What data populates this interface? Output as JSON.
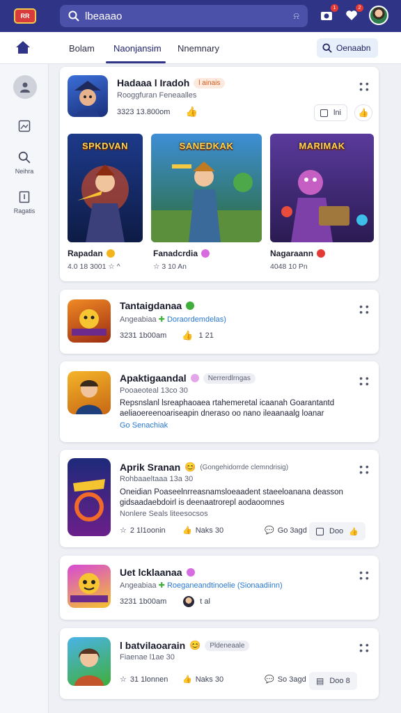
{
  "app": {
    "logo_text": "RR"
  },
  "search": {
    "value": "lbeaaao"
  },
  "topbar": {
    "badge1": "1",
    "badge2": "2"
  },
  "tabs": [
    "Bolam",
    "Naonjansim",
    "Nnemnary"
  ],
  "header_action": {
    "label": "Oenaabn"
  },
  "sidebar": {
    "items": [
      {
        "label": ""
      },
      {
        "label": "Neihra"
      },
      {
        "label": "Ragatis"
      }
    ]
  },
  "colors": {
    "primary": "#2f3486",
    "accent": "#2a78d1",
    "badge_red": "#e53935"
  },
  "featured_card": {
    "title": "Hadaaa l Iradoh",
    "tag": "l ainais",
    "subtitle": "Rooggfuran Feneaalles",
    "meta": "3323 13.800om",
    "action_label": "lni",
    "games": [
      {
        "art_title": "SPKDVAN",
        "name": "Rapadan",
        "meta": "4.0 18 3001   ☆ ^"
      },
      {
        "art_title": "SANEDKAK",
        "name": "Fanadcrdia",
        "meta": "☆ 3 10 An"
      },
      {
        "art_title": "MARIMAK",
        "name": "Nagaraann",
        "meta": "4048 10 Pn"
      }
    ]
  },
  "cards": [
    {
      "title": "Tantaigdanaa",
      "subtitle": "Angeabiaa",
      "link": "Doraordemdelas)",
      "meta": "3231 1b00am",
      "stat": "1 21"
    },
    {
      "title": "Apaktigaandal",
      "tag": "Nerrerdlrngas",
      "subtitle": "Pooaeoteal 13co 30",
      "description": "Repsnslanl lsreaphaoaea rtahemeretal icaanah Goarantantd aeliaoereenoariseapin dneraso oo nano ileaanaalg loanar",
      "see_more": "Go Senachiak"
    },
    {
      "title": "Aprik Sranan",
      "tag_text": "(Gongehidorrde clemndrisig)",
      "subtitle": "Rohbaaeltaaa 13a 30",
      "description": "Oneidian Poaseelnrreasnamsloeaadent staeeloanana deasson gidsaadaebdoirl is deenaatrorepl aodaoomnes",
      "note": "Nonlere Seals liteesocsos",
      "stat1": "2 1l1oonin",
      "stat2": "Naks 30",
      "stat3": "Go 3agd",
      "button": "Doo"
    },
    {
      "title": "Uet lcklaanaa",
      "subtitle": "Angeabiaa",
      "link": "Roeganeandtinoelie (Sionaadiinn)",
      "meta": "3231 1b00am",
      "stat": "t al"
    },
    {
      "title": "l batvilaoarain",
      "tag": "Pldeneaale",
      "subtitle": "Fiaenae l1ae 30",
      "stat1": "31 1lonnen",
      "stat2": "Naks 30",
      "stat3": "So 3agd",
      "button": "Doo 8"
    }
  ]
}
